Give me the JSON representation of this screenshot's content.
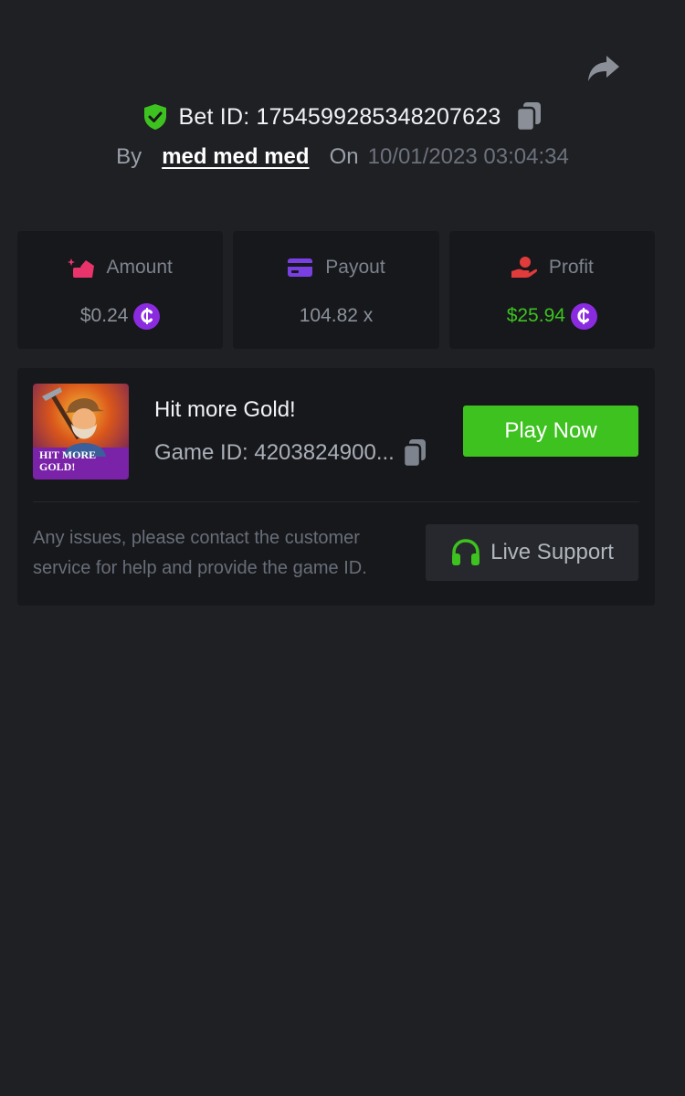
{
  "header": {
    "bet_id_label": "Bet ID: 1754599285348207623",
    "by_label": "By",
    "username": "med med med",
    "on_label": "On",
    "datetime": "10/01/2023 03:04:34"
  },
  "stats": [
    {
      "label": "Amount",
      "value": "$0.24",
      "icon": "coins-icon",
      "has_coin": true
    },
    {
      "label": "Payout",
      "value": "104.82 x",
      "icon": "card-icon",
      "has_coin": false
    },
    {
      "label": "Profit",
      "value": "$25.94",
      "icon": "hand-coin-icon",
      "has_coin": true
    }
  ],
  "game": {
    "title": "Hit more Gold!",
    "game_id": "Game ID: 4203824900...",
    "thumb_text_line1": "HIT MORE",
    "thumb_text_line2": "GOLD!",
    "play_label": "Play Now"
  },
  "support": {
    "note": "Any issues, please contact the customer service for help and provide the game ID.",
    "button_label": "Live Support"
  },
  "colors": {
    "background": "#1f2024",
    "card": "#17181c",
    "accent_green": "#3dc21f",
    "coin_purple": "#8b2be0",
    "amount_pink": "#e9346b",
    "payout_purple": "#7a3fe0",
    "profit_red": "#e23b3b"
  }
}
